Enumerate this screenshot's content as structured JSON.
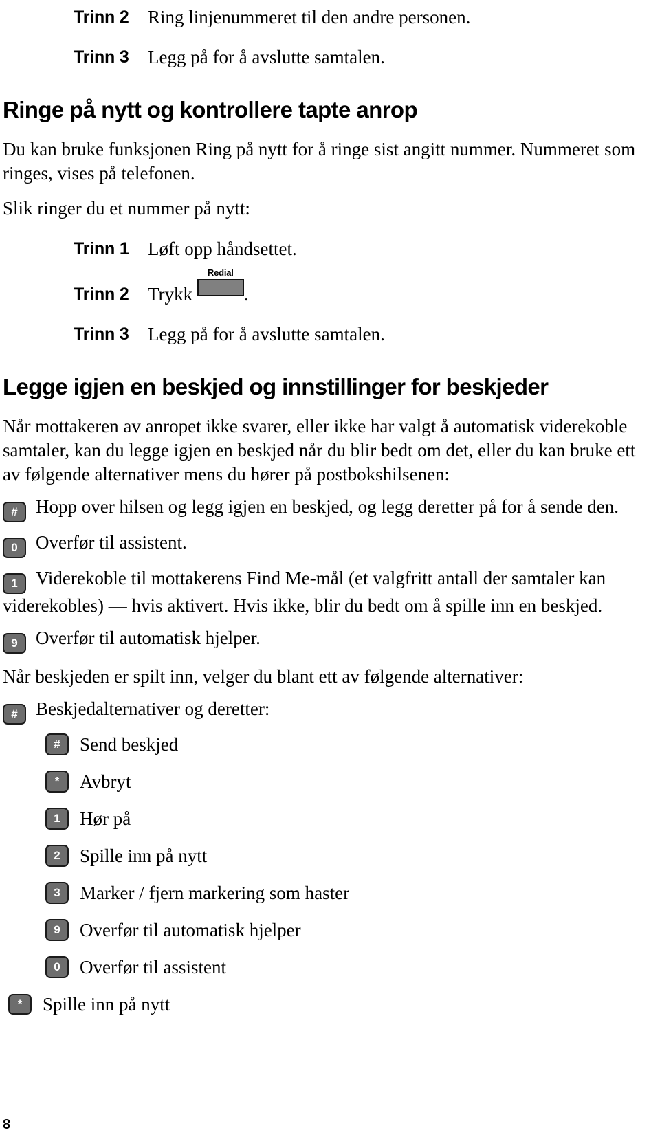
{
  "document": {
    "language": "Norwegian",
    "page_number": "8"
  },
  "top_steps": [
    {
      "label": "Trinn 2",
      "text": "Ring linjenummeret til den andre personen."
    },
    {
      "label": "Trinn 3",
      "text": "Legg på for å avslutte samtalen."
    }
  ],
  "section_redial": {
    "heading": "Ringe på nytt og kontrollere tapte anrop",
    "intro": "Du kan bruke funksjonen Ring på nytt for å ringe sist angitt nummer. Nummeret som ringes, vises på telefonen.",
    "lead_in": "Slik ringer du et nummer på nytt:",
    "steps": [
      {
        "label": "Trinn 1",
        "text": "Løft opp håndsettet."
      },
      {
        "label": "Trinn 2",
        "text_before": "Trykk",
        "button_caption": "Redial",
        "text_after": "."
      },
      {
        "label": "Trinn 3",
        "text": "Legg på for å avslutte samtalen."
      }
    ]
  },
  "section_message": {
    "heading": "Legge igjen en beskjed og innstillinger for beskjeder",
    "intro": "Når mottakeren av anropet ikke svarer, eller ikke har valgt å automatisk viderekoble samtaler, kan du legge igjen en beskjed når du blir bedt om det, eller du kan bruke ett av følgende alternativer mens du hører på postbokshilsenen:",
    "options": [
      {
        "key": "#",
        "text": "Hopp over hilsen og legg igjen en beskjed, og legg deretter på for å sende den."
      },
      {
        "key": "0",
        "text": "Overfør til assistent."
      },
      {
        "key": "1",
        "text": "Viderekoble til mottakerens Find Me-mål (et valgfritt antall der samtaler kan viderekobles) — hvis aktivert. Hvis ikke, blir du bedt om å spille inn en beskjed."
      },
      {
        "key": "9",
        "text": "Overfør til automatisk hjelper."
      }
    ],
    "after_recording_lead": "Når beskjeden er spilt inn, velger du blant ett av følgende alternativer:",
    "after_recording_options": [
      {
        "key": "#",
        "text": "Beskjedalternativer og deretter:"
      }
    ],
    "sub_options": [
      {
        "key": "#",
        "text": "Send beskjed"
      },
      {
        "key": "*",
        "text": "Avbryt"
      },
      {
        "key": "1",
        "text": "Hør på"
      },
      {
        "key": "2",
        "text": "Spille inn på nytt"
      },
      {
        "key": "3",
        "text": "Marker / fjern markering som haster"
      },
      {
        "key": "9",
        "text": "Overfør til automatisk hjelper"
      },
      {
        "key": "0",
        "text": "Overfør til assistent"
      }
    ],
    "final_option": {
      "key": "*",
      "text": "Spille inn på nytt"
    }
  },
  "colors": {
    "key_fill": "#6d6d6d",
    "key_border": "#1b1b1b",
    "key_text": "#ffffff",
    "redial_fill": "#808080",
    "page_bg": "#ffffff",
    "text": "#000000"
  }
}
